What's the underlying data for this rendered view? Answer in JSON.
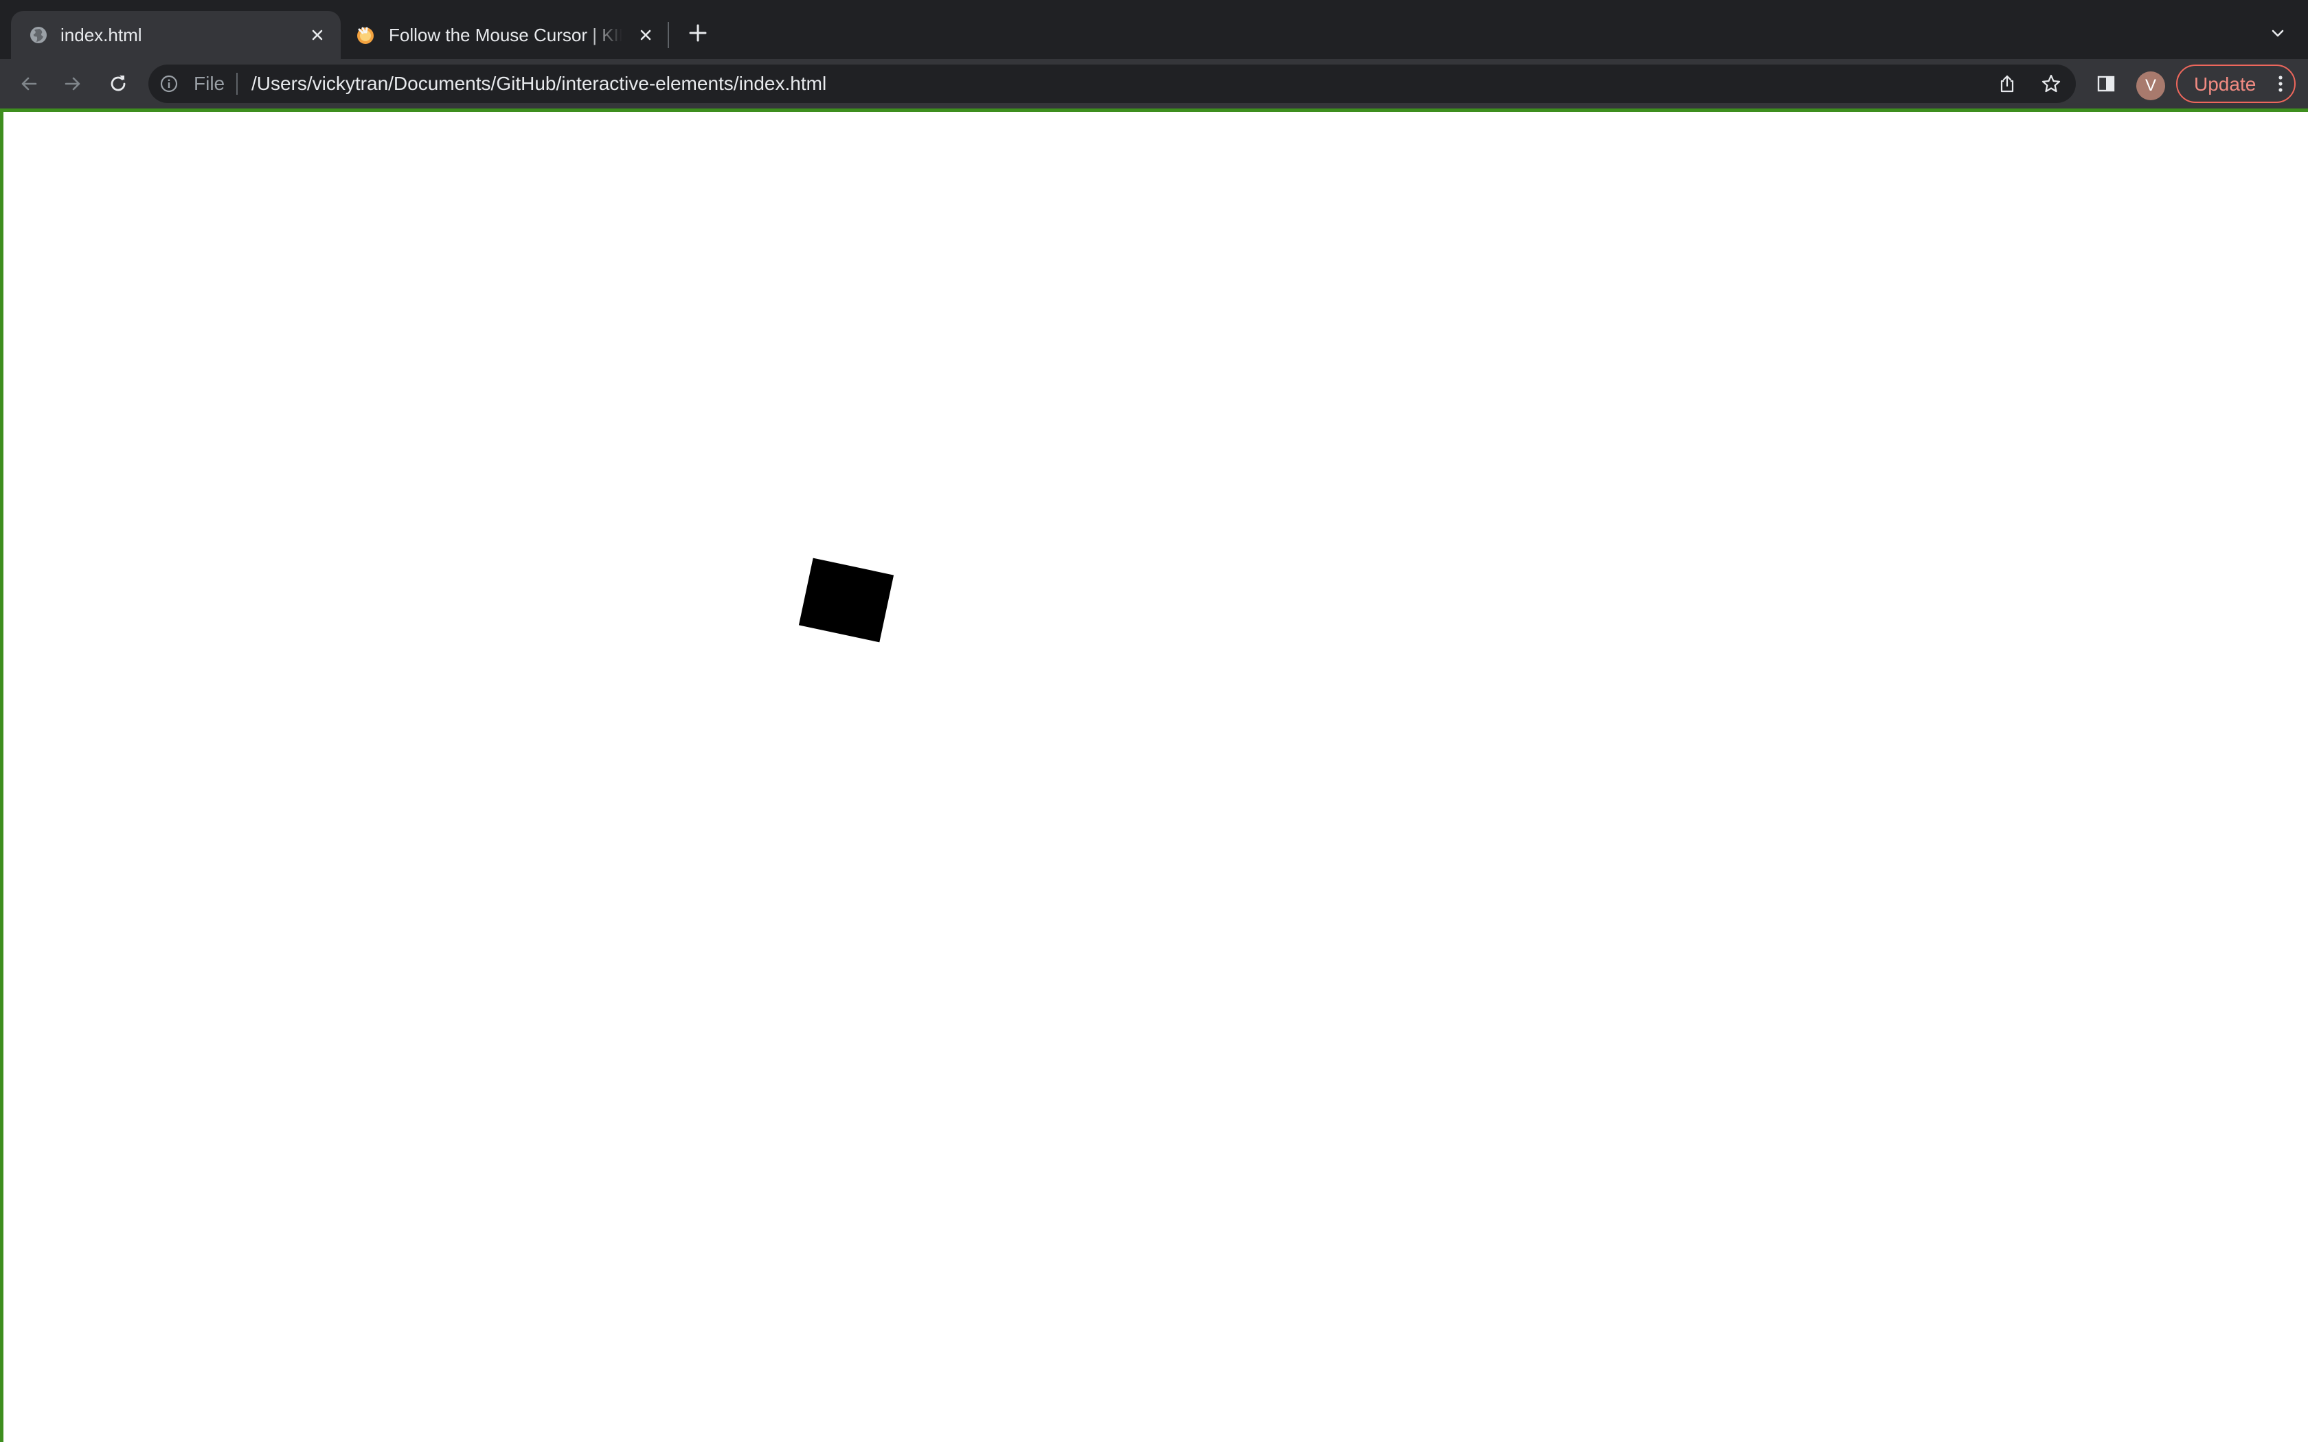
{
  "browser": {
    "tabs": [
      {
        "title": "index.html",
        "favicon": "globe-icon",
        "active": true
      },
      {
        "title": "Follow the Mouse Cursor | KIRU",
        "favicon": "kiru-favicon-icon",
        "active": false
      }
    ],
    "new_tab_icon": "plus-icon",
    "tab_search_icon": "chevron-down-icon",
    "toolbar": {
      "back_icon": "back-arrow-icon",
      "forward_icon": "forward-arrow-icon",
      "reload_icon": "reload-icon",
      "omnibox": {
        "info_icon": "info-icon",
        "scheme": "File",
        "url": "/Users/vickytran/Documents/GitHub/interactive-elements/index.html",
        "share_icon": "share-icon",
        "bookmark_icon": "star-icon"
      },
      "side_panel_icon": "side-panel-icon",
      "profile_initial": "V",
      "update_label": "Update",
      "menu_icon": "kebab-menu-icon"
    }
  },
  "page": {
    "background": "#ffffff",
    "focus_outline_color": "#3e8e1e",
    "shape": {
      "color": "#000000",
      "rotation_deg": 12
    }
  }
}
